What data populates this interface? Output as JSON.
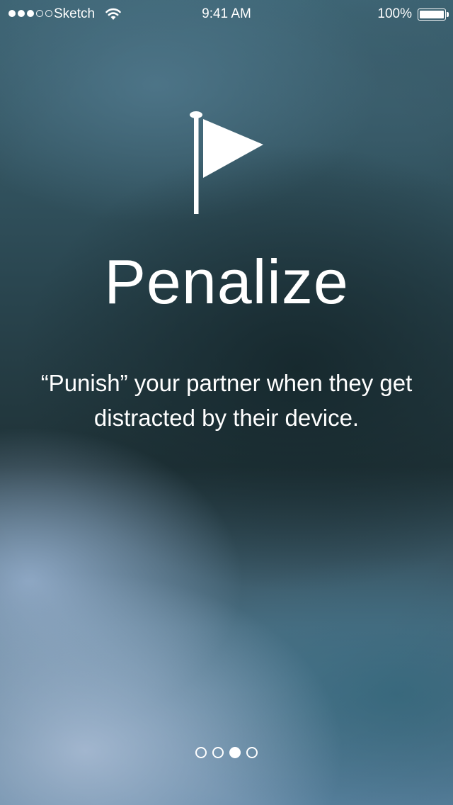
{
  "status_bar": {
    "signal_bars": 3,
    "signal_total": 5,
    "carrier": "Sketch",
    "wifi_icon": "wifi-icon",
    "time": "9:41 AM",
    "battery_percent": "100%",
    "battery_level": 1.0
  },
  "onboarding": {
    "icon": "flag-icon",
    "title": "Penalize",
    "description": "“Punish” your partner when they get distracted by their device."
  },
  "pager": {
    "total_pages": 4,
    "current_page": 3
  },
  "colors": {
    "text": "#ffffff"
  }
}
